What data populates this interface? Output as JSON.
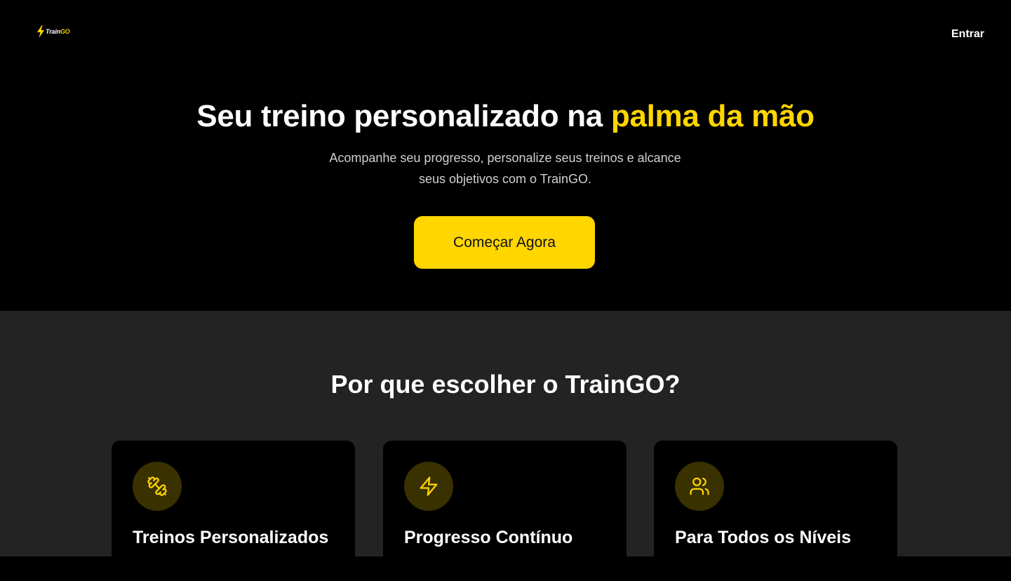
{
  "header": {
    "logo": {
      "prefix": "Train",
      "suffix": "GO",
      "icon": "lightning-bolt-icon"
    },
    "signin_label": "Entrar"
  },
  "hero": {
    "title_main": "Seu treino personalizado na ",
    "title_accent": "palma da mão",
    "subtitle_line1": "Acompanhe seu progresso, personalize seus treinos e alcance",
    "subtitle_line2": "seus objetivos com o TrainGO.",
    "cta_label": "Começar Agora"
  },
  "features": {
    "title": "Por que escolher o TrainGO?",
    "cards": [
      {
        "icon": "dumbbell-icon",
        "title": "Treinos Personalizados"
      },
      {
        "icon": "lightning-bolt-icon",
        "title": "Progresso Contínuo"
      },
      {
        "icon": "users-icon",
        "title": "Para Todos os Níveis"
      }
    ]
  },
  "colors": {
    "accent": "#FFD600",
    "background": "#000000",
    "section_bg": "#232323",
    "icon_circle_bg": "#3a3100"
  }
}
